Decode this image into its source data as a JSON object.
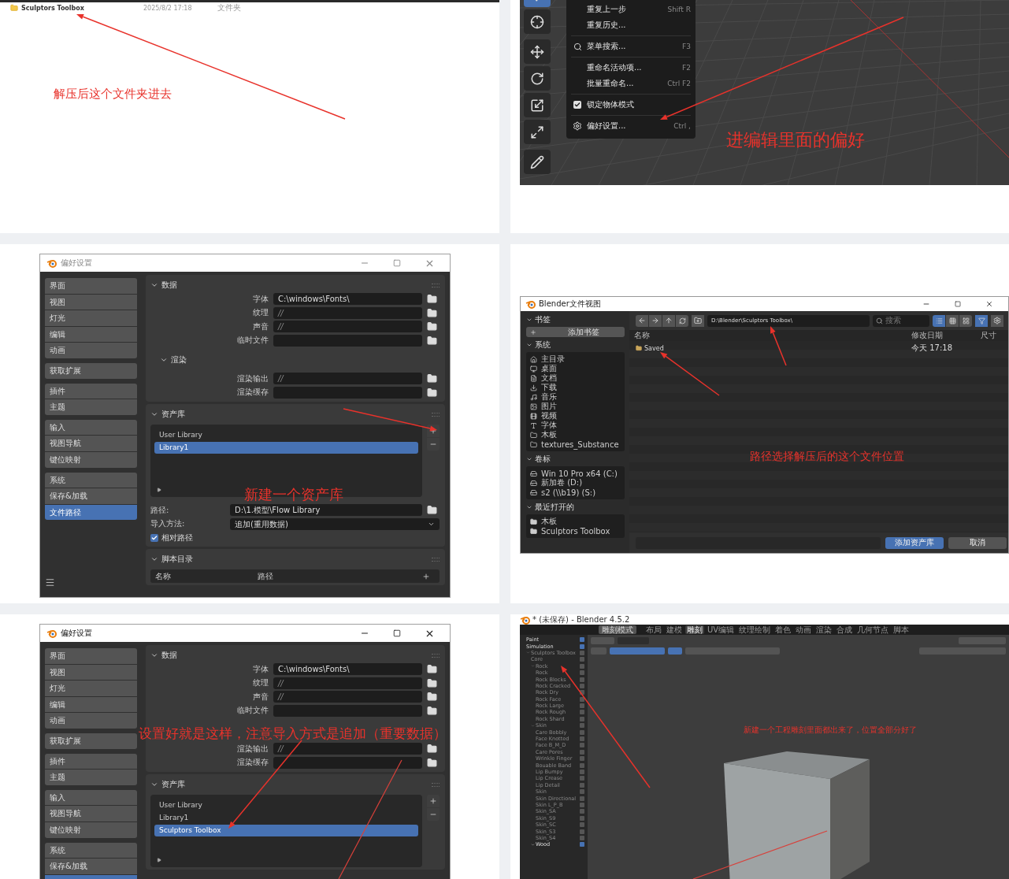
{
  "explorer": {
    "row": {
      "name": "Sculptors Toolbox",
      "modified": "2025/8/2 17:18",
      "type": "文件夹"
    },
    "note": "解压后这个文件夹进去"
  },
  "edit_menu": {
    "tools": [
      {
        "kind": "select",
        "selected": true
      },
      {
        "kind": "cursor",
        "selected": false
      },
      {
        "kind": "move",
        "selected": false
      },
      {
        "kind": "rotate",
        "selected": false
      },
      {
        "kind": "scale",
        "selected": false
      },
      {
        "kind": "transform",
        "selected": false
      },
      {
        "kind": "annotate",
        "selected": false
      }
    ],
    "items": [
      {
        "kind": "item",
        "label": "重复上一步",
        "shortcut": "Shift R"
      },
      {
        "kind": "item",
        "label": "重复历史..."
      },
      {
        "kind": "separator"
      },
      {
        "kind": "search",
        "label": "菜单搜索...",
        "shortcut": "F3"
      },
      {
        "kind": "separator"
      },
      {
        "kind": "item",
        "label": "重命名活动项...",
        "shortcut": "F2"
      },
      {
        "kind": "item",
        "label": "批量重命名...",
        "shortcut": "Ctrl F2"
      },
      {
        "kind": "separator"
      },
      {
        "kind": "check",
        "label": "锁定物体模式",
        "checked": true
      },
      {
        "kind": "separator"
      },
      {
        "kind": "settings",
        "label": "偏好设置...",
        "shortcut": "Ctrl ,"
      }
    ],
    "note": "进编辑里面的偏好"
  },
  "prefs_before": {
    "title": "偏好设置",
    "active": false,
    "sidebar": [
      [
        {
          "label": "界面",
          "selected": false
        },
        {
          "label": "视图",
          "selected": false
        },
        {
          "label": "灯光",
          "selected": false
        },
        {
          "label": "编辑",
          "selected": false
        },
        {
          "label": "动画",
          "selected": false
        }
      ],
      [
        {
          "label": "获取扩展",
          "selected": false
        }
      ],
      [
        {
          "label": "插件",
          "selected": false
        },
        {
          "label": "主题",
          "selected": false
        }
      ],
      [
        {
          "label": "输入",
          "selected": false
        },
        {
          "label": "视图导航",
          "selected": false
        },
        {
          "label": "键位映射",
          "selected": false
        }
      ],
      [
        {
          "label": "系统",
          "selected": false
        },
        {
          "label": "保存&加载",
          "selected": false
        },
        {
          "label": "文件路径",
          "selected": true
        }
      ]
    ],
    "data_section": {
      "title": "数据",
      "fields": [
        {
          "label": "字体",
          "value": "C:\\windows\\Fonts\\"
        },
        {
          "label": "纹理",
          "value": "//"
        },
        {
          "label": "声音",
          "value": "//"
        },
        {
          "label": "临时文件"
        }
      ],
      "render": {
        "title": "渲染",
        "fields": [
          {
            "label": "渲染输出",
            "value": "//"
          },
          {
            "label": "渲染缓存"
          }
        ]
      }
    },
    "assets": {
      "title": "资产库",
      "libraries": [
        {
          "name": "User Library",
          "selected": false
        },
        {
          "name": "Library1",
          "selected": true
        }
      ],
      "path_label": "路径:",
      "path": "D:\\1.模型\\Flow Library",
      "import_label": "导入方法:",
      "import": "追加(重用数据)",
      "relative": {
        "label": "相对路径",
        "checked": true
      }
    },
    "scripts": {
      "title": "脚本目录",
      "columns": [
        "名称",
        "路径"
      ]
    },
    "note": "新建一个资产库"
  },
  "file_browser": {
    "title": "Blender文件视图",
    "bookmarks": {
      "title": "书签",
      "add": "添加书签"
    },
    "system": {
      "title": "系统",
      "items": [
        {
          "kind": "home",
          "label": "主目录"
        },
        {
          "kind": "desktop",
          "label": "桌面"
        },
        {
          "kind": "documents",
          "label": "文档"
        },
        {
          "kind": "downloads",
          "label": "下载"
        },
        {
          "kind": "music",
          "label": "音乐"
        },
        {
          "kind": "pictures",
          "label": "图片"
        },
        {
          "kind": "videos",
          "label": "视频"
        },
        {
          "kind": "fonts",
          "label": "字体"
        },
        {
          "kind": "folder",
          "label": "木板"
        },
        {
          "kind": "folder",
          "label": "textures_Substance"
        }
      ]
    },
    "volumes": {
      "title": "卷标",
      "items": [
        {
          "label": "Win 10 Pro x64 (C:)"
        },
        {
          "label": "新加卷 (D:)"
        },
        {
          "label": "s2 (\\\\b19) (S:)"
        }
      ]
    },
    "recent": {
      "title": "最近打开的",
      "items": [
        {
          "label": "木板"
        },
        {
          "label": "Sculptors Toolbox"
        }
      ]
    },
    "path": "D:\\Blender\\Sculptors Toolbox\\",
    "search_placeholder": "搜索",
    "view_modes": [
      {
        "selected": true
      },
      {
        "selected": false
      },
      {
        "selected": false
      }
    ],
    "filter_on": true,
    "columns": [
      "名称",
      "修改日期",
      "尺寸"
    ],
    "files": [
      {
        "name": "Saved",
        "modified": "今天 17:18"
      }
    ],
    "confirm": "添加资产库",
    "cancel": "取消",
    "note": "路径选择解压后的这个文件位置"
  },
  "prefs_after": {
    "title": "偏好设置",
    "active": true,
    "sidebar": [
      [
        {
          "label": "界面",
          "selected": false
        },
        {
          "label": "视图",
          "selected": false
        },
        {
          "label": "灯光",
          "selected": false
        },
        {
          "label": "编辑",
          "selected": false
        },
        {
          "label": "动画",
          "selected": false
        }
      ],
      [
        {
          "label": "获取扩展",
          "selected": false
        }
      ],
      [
        {
          "label": "插件",
          "selected": false
        },
        {
          "label": "主题",
          "selected": false
        }
      ],
      [
        {
          "label": "输入",
          "selected": false
        },
        {
          "label": "视图导航",
          "selected": false
        },
        {
          "label": "键位映射",
          "selected": false
        }
      ],
      [
        {
          "label": "系统",
          "selected": false
        },
        {
          "label": "保存&加载",
          "selected": false
        },
        {
          "selected": true
        }
      ]
    ],
    "data_section": {
      "title": "数据",
      "fields": [
        {
          "label": "字体",
          "value": "C:\\windows\\Fonts\\"
        },
        {
          "label": "纹理",
          "value": "//"
        },
        {
          "label": "声音",
          "value": "//"
        },
        {
          "label": "临时文件"
        }
      ],
      "render": {
        "fields": [
          {
            "label": "渲染输出",
            "value": "//"
          },
          {
            "label": "渲染缓存"
          }
        ]
      }
    },
    "assets": {
      "title": "资产库",
      "libraries": [
        {
          "name": "User Library",
          "selected": false
        },
        {
          "name": "Library1",
          "selected": false
        },
        {
          "name": "Sculptors Toolbox",
          "selected": true
        }
      ]
    },
    "note": "设置好就是这样，注意导入方式是追加（重要数据）"
  },
  "blender_main": {
    "title": "* (未保存) - Blender 4.5.2",
    "mode": "雕刻模式",
    "workspaces": [
      {
        "label": "布局",
        "selected": false
      },
      {
        "label": "建模",
        "selected": false
      },
      {
        "label": "雕刻",
        "selected": true
      },
      {
        "label": "UV编辑",
        "selected": false
      },
      {
        "label": "纹理绘制",
        "selected": false
      },
      {
        "label": "着色",
        "selected": false
      },
      {
        "label": "动画",
        "selected": false
      },
      {
        "label": "渲染",
        "selected": false
      },
      {
        "label": "合成",
        "selected": false
      },
      {
        "label": "几何节点",
        "selected": false
      },
      {
        "label": "脚本",
        "selected": false
      }
    ],
    "outliner": [
      {
        "name": "Paint",
        "checked": true
      },
      {
        "name": "Simulation",
        "checked": true
      },
      {
        "name": "Sculptors Toolbox",
        "checked": false,
        "expanded": true,
        "children": [
          {
            "name": "Core",
            "checked": false
          },
          {
            "name": "Rock",
            "checked": false,
            "expanded": true,
            "children": [
              {
                "name": "Rock",
                "checked": false
              },
              {
                "name": "Rock Blocks",
                "checked": false
              },
              {
                "name": "Rock Cracked",
                "checked": false
              },
              {
                "name": "Rock Dry",
                "checked": false
              },
              {
                "name": "Rock Face",
                "checked": false
              },
              {
                "name": "Rock Large",
                "checked": false
              },
              {
                "name": "Rock Rough",
                "checked": false
              },
              {
                "name": "Rock Shard",
                "checked": false
              }
            ]
          },
          {
            "name": "Skin",
            "checked": false,
            "expanded": true,
            "children": [
              {
                "name": "Care Bobbly",
                "checked": false
              },
              {
                "name": "Face Knotted",
                "checked": false
              },
              {
                "name": "Face B_M_D",
                "checked": false
              },
              {
                "name": "Care Pores",
                "checked": false
              },
              {
                "name": "Wrinkle Finger",
                "checked": false
              },
              {
                "name": "Bouable Band",
                "checked": false
              },
              {
                "name": "Lip Bumpy",
                "checked": false
              },
              {
                "name": "Lip Crease",
                "checked": false
              },
              {
                "name": "Lip Detail",
                "checked": false
              },
              {
                "name": "Skin",
                "checked": false
              },
              {
                "name": "Skin Directional",
                "checked": false
              },
              {
                "name": "Skin L_P_B",
                "checked": false
              },
              {
                "name": "Skin_SA",
                "checked": false
              },
              {
                "name": "Skin_S9",
                "checked": false
              },
              {
                "name": "Skin_SC",
                "checked": false
              },
              {
                "name": "Skin_S3",
                "checked": false
              },
              {
                "name": "Skin_S4",
                "checked": false
              }
            ]
          },
          {
            "name": "Wood",
            "checked": true,
            "expanded": true
          }
        ]
      }
    ],
    "note": "新建一个工程雕刻里面都出来了，位置全部分好了"
  }
}
